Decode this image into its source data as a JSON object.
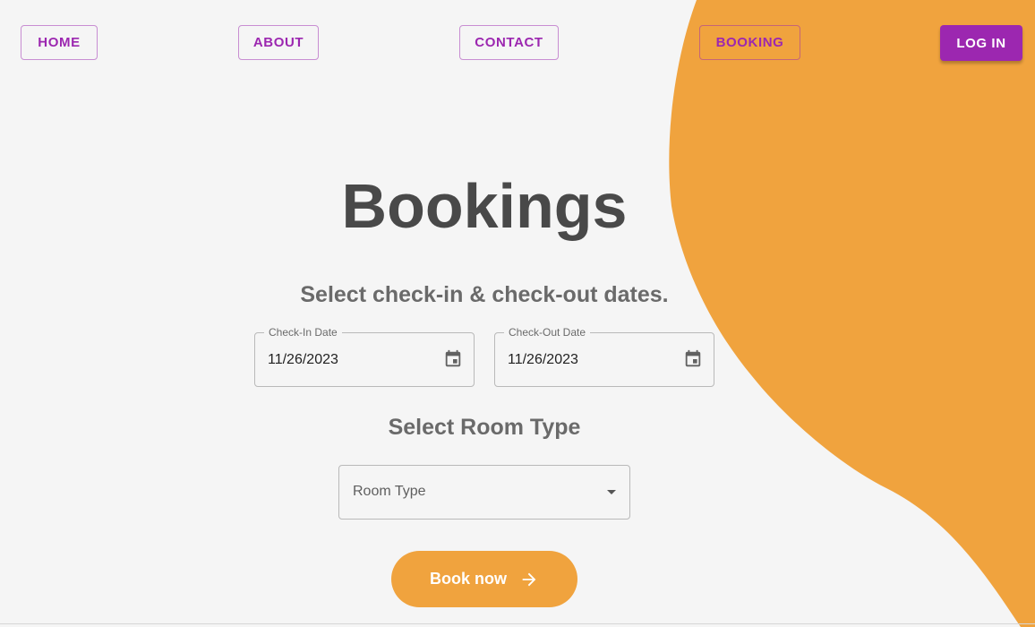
{
  "colors": {
    "background": "#f5f5f5",
    "accent_orange": "#f0a33e",
    "nav_purple": "#9c27b0",
    "title_text": "#494949",
    "subtitle_text": "#6a6a6a"
  },
  "nav": {
    "items": [
      {
        "label": "HOME"
      },
      {
        "label": "ABOUT"
      },
      {
        "label": "CONTACT"
      },
      {
        "label": "BOOKING"
      }
    ],
    "login_label": "LOG IN"
  },
  "main": {
    "title": "Bookings",
    "dates_heading": "Select check-in & check-out dates.",
    "check_in": {
      "label": "Check-In Date",
      "value": "11/26/2023",
      "icon": "calendar-icon"
    },
    "check_out": {
      "label": "Check-Out Date",
      "value": "11/26/2023",
      "icon": "calendar-icon"
    },
    "room_heading": "Select Room Type",
    "room_type": {
      "label": "Room Type",
      "icon": "dropdown-caret-icon"
    },
    "book_button": {
      "label": "Book now",
      "icon": "arrow-right-icon"
    }
  }
}
